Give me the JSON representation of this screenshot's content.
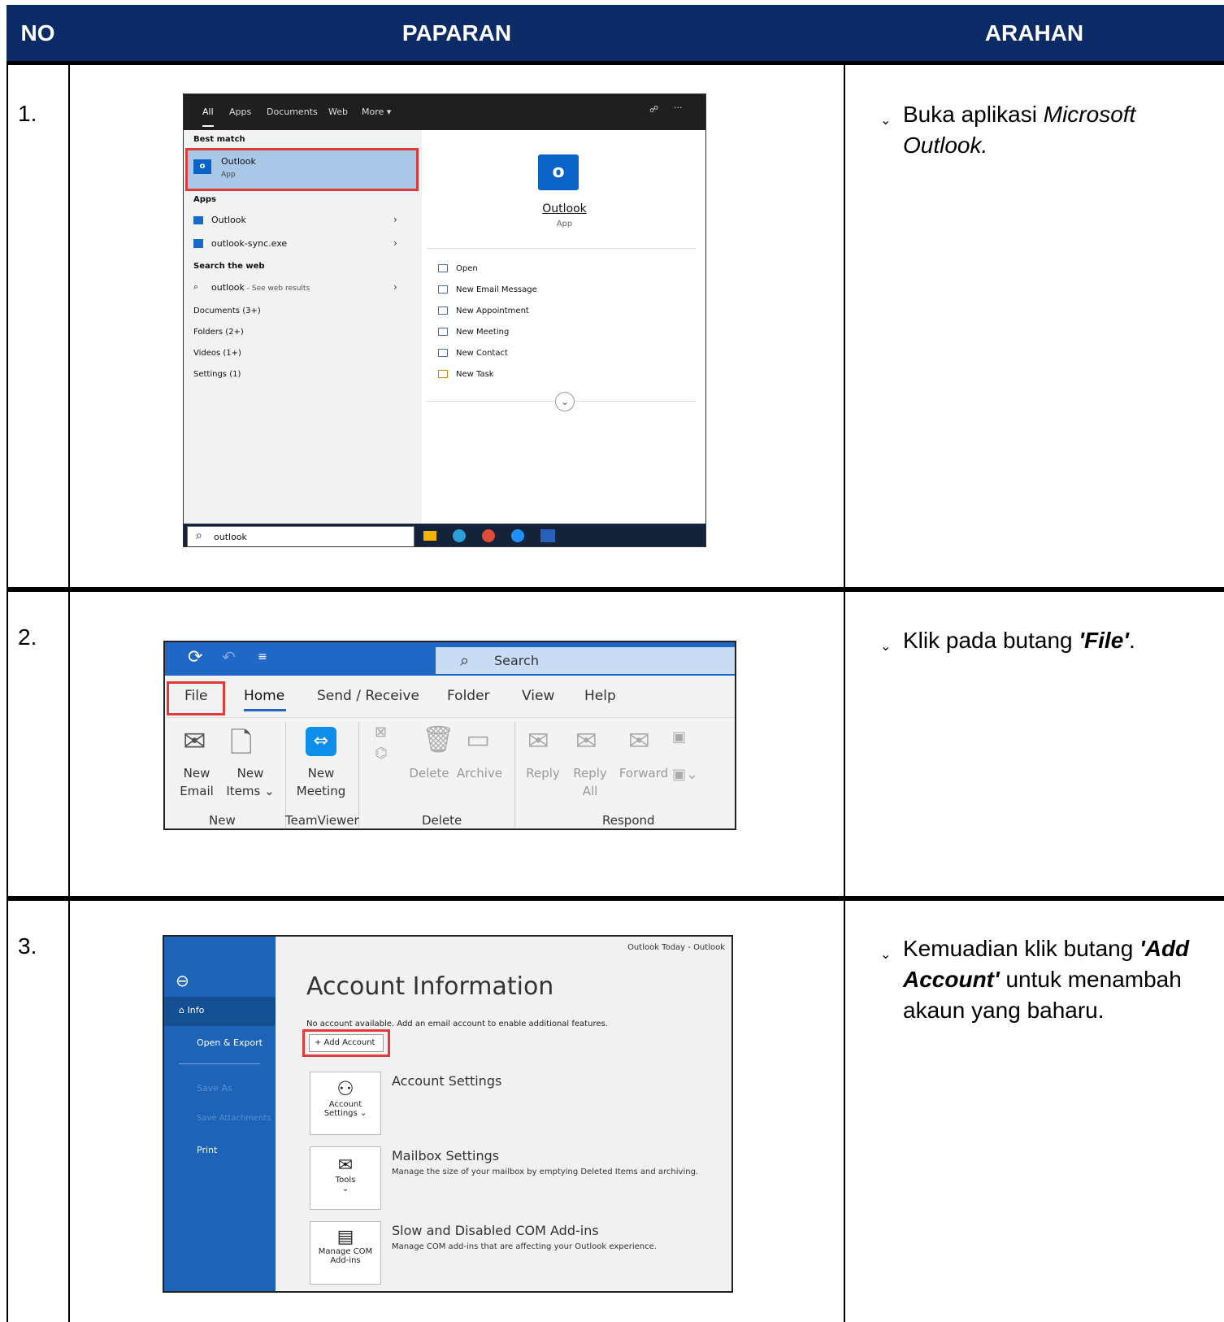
{
  "header": {
    "no": "NO",
    "paparan": "PAPARAN",
    "arahan": "ARAHAN"
  },
  "rows": [
    {
      "no": "1.",
      "arahan_prefix": "Buka aplikasi ",
      "arahan_italic": "Microsoft Outlook.",
      "bullet": "⌄"
    },
    {
      "no": "2.",
      "arahan_prefix": "Klik pada butang ",
      "arahan_bold_italic": "'File'",
      "arahan_suffix": ".",
      "bullet": "⌄"
    },
    {
      "no": "3.",
      "arahan_prefix": "Kemuadian klik butang ",
      "arahan_bold_italic": "'Add Account'",
      "arahan_suffix": " untuk menambah akaun yang baharu.",
      "bullet": "⌄"
    }
  ],
  "shot1": {
    "tabs": [
      "All",
      "Apps",
      "Documents",
      "Web",
      "More ▾"
    ],
    "best_match": "Best match",
    "best_app": "Outlook",
    "best_app_type": "App",
    "apps_label": "Apps",
    "apps": [
      "Outlook",
      "outlook-sync.exe"
    ],
    "search_web": "Search the web",
    "web_query": "outlook",
    "web_hint": " - See web results",
    "categories": [
      "Documents (3+)",
      "Folders (2+)",
      "Videos (1+)",
      "Settings (1)"
    ],
    "right_title": "Outlook",
    "right_type": "App",
    "actions": [
      "Open",
      "New Email Message",
      "New Appointment",
      "New Meeting",
      "New Contact",
      "New Task"
    ],
    "search_value": "outlook"
  },
  "shot2": {
    "search": "Search",
    "tabs": [
      "File",
      "Home",
      "Send / Receive",
      "Folder",
      "View",
      "Help"
    ],
    "buttons": {
      "new_email": "New\nEmail",
      "new_items": "New\nItems ⌄",
      "new_meeting": "New\nMeeting",
      "delete": "Delete",
      "archive": "Archive",
      "reply": "Reply",
      "reply_all": "Reply\nAll",
      "forward": "Forward"
    },
    "groups": [
      "New",
      "TeamViewer",
      "Delete",
      "Respond"
    ]
  },
  "shot3": {
    "window_title": "Outlook Today  -  Outlook",
    "side": [
      "Info",
      "Open & Export",
      "Save As",
      "Save Attachments",
      "Print"
    ],
    "heading": "Account Information",
    "notice": "No account available. Add an email account to enable additional features.",
    "add_account": "+ Add Account",
    "cards": [
      {
        "btn": "Account\nSettings ⌄",
        "title": "Account Settings",
        "desc": ""
      },
      {
        "btn": "Tools\n⌄",
        "title": "Mailbox Settings",
        "desc": "Manage the size of your mailbox by emptying Deleted Items and archiving."
      },
      {
        "btn": "Manage COM\nAdd-ins",
        "title": "Slow and Disabled COM Add-ins",
        "desc": "Manage COM add-ins that are affecting your Outlook experience."
      }
    ]
  },
  "colors": {
    "header_bg": "#0c2a66",
    "outlook_blue": "#1d64b8",
    "highlight_red": "#e03a3a"
  }
}
